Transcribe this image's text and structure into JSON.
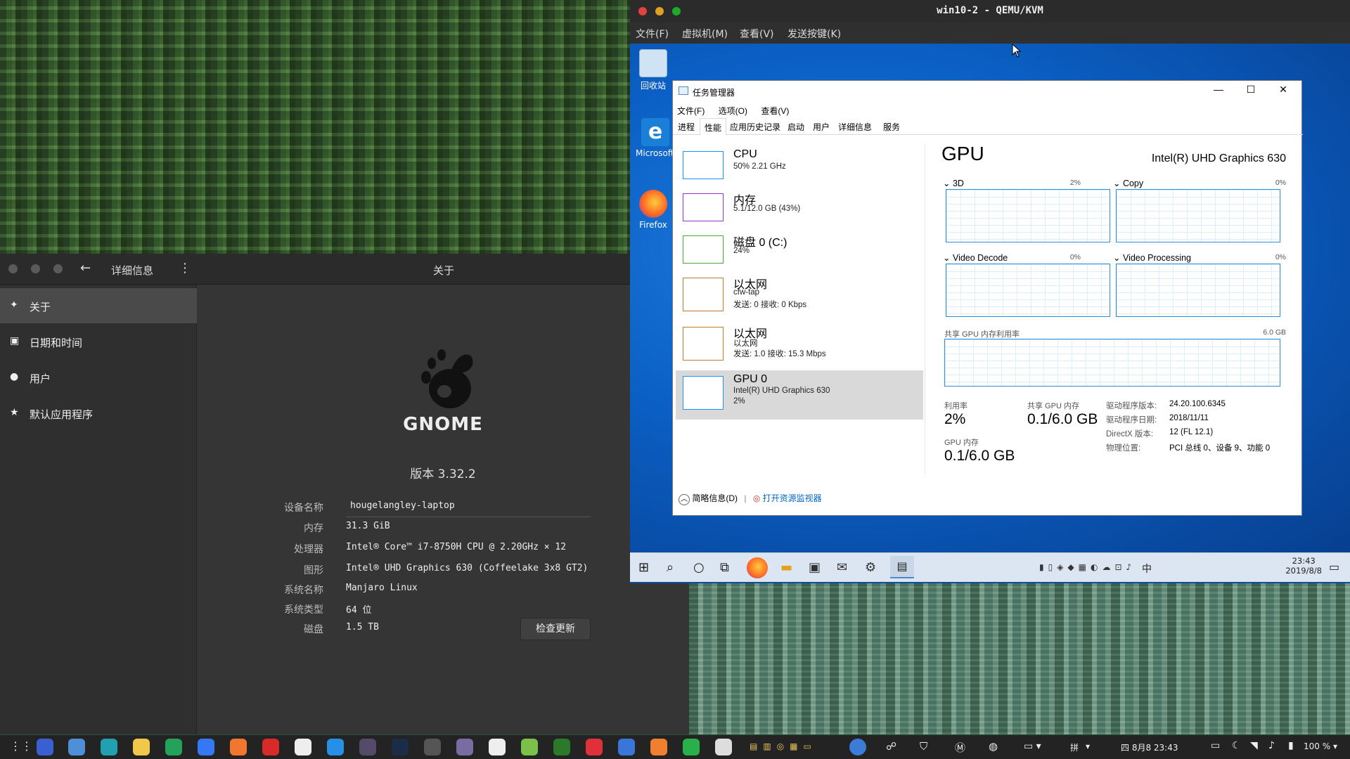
{
  "gnome": {
    "header_title": "详细信息",
    "window_title": "关于",
    "sidebar": [
      {
        "label": "关于",
        "icon": "star-icon"
      },
      {
        "label": "日期和时间",
        "icon": "calendar-icon"
      },
      {
        "label": "用户",
        "icon": "user-icon"
      },
      {
        "label": "默认应用程序",
        "icon": "star-icon"
      }
    ],
    "logo_text": "GNOME",
    "version": "版本 3.32.2",
    "details": {
      "device_name_label": "设备名称",
      "device_name": "hougelangley-laptop",
      "memory_label": "内存",
      "memory": "31.3 GiB",
      "processor_label": "处理器",
      "processor": "Intel® Core™ i7-8750H CPU @ 2.20GHz × 12",
      "graphics_label": "图形",
      "graphics": "Intel® UHD Graphics 630 (Coffeelake 3x8 GT2)",
      "os_label": "系统名称",
      "os": "Manjaro Linux",
      "type_label": "系统类型",
      "type": "64 位",
      "disk_label": "磁盘",
      "disk": "1.5 TB"
    },
    "update_button": "检查更新"
  },
  "qemu": {
    "title": "win10-2 - QEMU/KVM",
    "menu": [
      "文件(F)",
      "虚拟机(M)",
      "查看(V)",
      "发送按键(K)"
    ],
    "desktop_icons": [
      "回收站",
      "Microsoft Edge",
      "Firefox"
    ]
  },
  "taskmgr": {
    "title": "任务管理器",
    "menu": [
      "文件(F)",
      "选项(O)",
      "查看(V)"
    ],
    "tabs": [
      "进程",
      "性能",
      "应用历史记录",
      "启动",
      "用户",
      "详细信息",
      "服务"
    ],
    "active_tab": "性能",
    "items": [
      {
        "name": "CPU",
        "sub1": "50% 2.21 GHz",
        "sub2": "",
        "color": "#1e90ff"
      },
      {
        "name": "内存",
        "sub1": "5.1/12.0 GB (43%)",
        "sub2": "",
        "color": "#9b30d9"
      },
      {
        "name": "磁盘 0 (C:)",
        "sub1": "24%",
        "sub2": "",
        "color": "#4aa832"
      },
      {
        "name": "以太网",
        "sub1": "cfw-tap",
        "sub2": "发送: 0 接收: 0 Kbps",
        "color": "#c77a2e"
      },
      {
        "name": "以太网",
        "sub1": "以太网",
        "sub2": "发送: 1.0 接收: 15.3 Mbps",
        "color": "#c77a2e"
      },
      {
        "name": "GPU 0",
        "sub1": "Intel(R) UHD Graphics 630",
        "sub2": "2%",
        "color": "#1e90ff"
      }
    ],
    "gpu": {
      "heading": "GPU",
      "model": "Intel(R) UHD Graphics 630",
      "engines": [
        {
          "name": "3D",
          "pct": "2%"
        },
        {
          "name": "Copy",
          "pct": "0%"
        },
        {
          "name": "Video Decode",
          "pct": "0%"
        },
        {
          "name": "Video Processing",
          "pct": "0%"
        }
      ],
      "shared_label": "共享 GPU 内存利用率",
      "shared_max": "6.0 GB",
      "util_label": "利用率",
      "util": "2%",
      "shared_mem_label": "共享 GPU 内存",
      "shared_mem": "0.1/6.0 GB",
      "gpu_mem_label": "GPU 内存",
      "gpu_mem": "0.1/6.0 GB",
      "driver_ver_label": "驱动程序版本:",
      "driver_ver": "24.20.100.6345",
      "driver_date_label": "驱动程序日期:",
      "driver_date": "2018/11/11",
      "directx_label": "DirectX 版本:",
      "directx": "12 (FL 12.1)",
      "location_label": "物理位置:",
      "location": "PCI 总线 0、设备 9、功能 0"
    },
    "footer_less": "简略信息(D)",
    "footer_monitor": "打开资源监视器"
  },
  "win_taskbar": {
    "time": "23:43",
    "date": "2019/8/8",
    "ime": "中"
  },
  "host_bar": {
    "date_time": "四 8月8  23:43",
    "volume": "100 %",
    "input": "拼"
  }
}
